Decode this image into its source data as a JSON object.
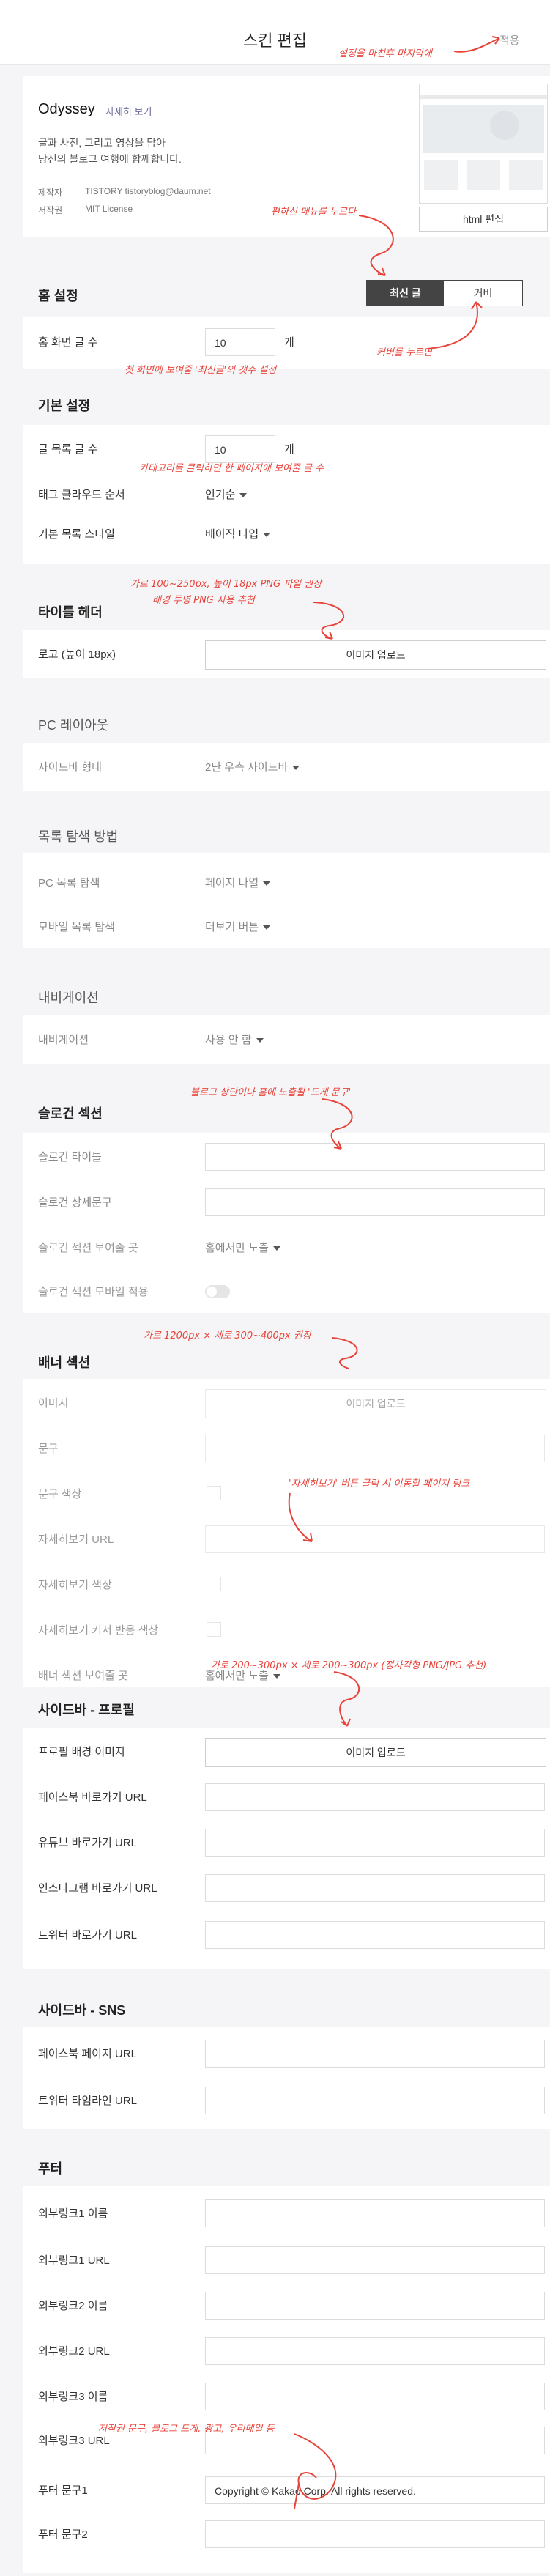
{
  "topbar": {
    "title": "스킨 편집",
    "apply_label": "적용"
  },
  "skin": {
    "name": "Odyssey",
    "detail_link": "자세히 보기",
    "description": "글과 사진, 그리고 영상을 담아\n당신의 블로그 여행에 함께합니다.",
    "meta": [
      {
        "label": "제작자",
        "value": "TISTORY  tistoryblog@daum.net"
      },
      {
        "label": "저작권",
        "value": "MIT License"
      }
    ],
    "html_edit_label": "html 편집"
  },
  "home": {
    "header": "홈 설정",
    "tabs": [
      {
        "label": "최신 글",
        "active": true
      },
      {
        "label": "커버",
        "active": false
      }
    ],
    "count_label": "홈 화면 글 수",
    "count_value": "10",
    "count_unit": "개"
  },
  "basic": {
    "header": "기본 설정",
    "list_count_label": "글 목록 글 수",
    "list_count_value": "10",
    "list_count_unit": "개",
    "tagcloud_label": "태그 클라우드 순서",
    "tagcloud_value": "인기순",
    "liststyle_label": "기본 목록 스타일",
    "liststyle_value": "베이직 타입"
  },
  "title_header": {
    "header": "타이틀 헤더",
    "logo_label": "로고 (높이 18px)",
    "upload_label": "이미지 업로드"
  },
  "pc_layout": {
    "header": "PC 레이아웃",
    "sidebar_label": "사이드바 형태",
    "sidebar_value": "2단 우측 사이드바"
  },
  "list_nav": {
    "header": "목록 탐색 방법",
    "pc_label": "PC 목록 탐색",
    "pc_value": "페이지 나열",
    "mobile_label": "모바일 목록 탐색",
    "mobile_value": "더보기 버튼"
  },
  "navigation": {
    "header": "내비게이션",
    "label": "내비게이션",
    "value": "사용 안 함"
  },
  "slogan": {
    "header": "슬로건 섹션",
    "title_label": "슬로건 타이틀",
    "desc_label": "슬로건 상세문구",
    "show_label": "슬로건 섹션 보여줄 곳",
    "show_value": "홈에서만 노출",
    "mobile_label": "슬로건 섹션 모바일 적용"
  },
  "banner": {
    "header": "배너 섹션",
    "image_label": "이미지",
    "upload_label": "이미지 업로드",
    "text_label": "문구",
    "text_color_label": "문구 색상",
    "more_url_label": "자세히보기 URL",
    "more_color_label": "자세히보기 색상",
    "cursor_label": "자세히보기 커서 반응 색상",
    "show_label": "배너 섹션 보여줄 곳",
    "show_value": "홈에서만 노출"
  },
  "profile": {
    "header": "사이드바 - 프로필",
    "bg_label": "프로필 배경 이미지",
    "upload_label": "이미지 업로드",
    "facebook_label": "페이스북 바로가기 URL",
    "youtube_label": "유튜브 바로가기 URL",
    "instagram_label": "인스타그램 바로가기 URL",
    "twitter_label": "트위터 바로가기 URL"
  },
  "sns": {
    "header": "사이드바 - SNS",
    "facebook_label": "페이스북 페이지 URL",
    "twitter_label": "트위터 타임라인 URL"
  },
  "footer": {
    "header": "푸터",
    "link1_name": "외부링크1 이름",
    "link1_url": "외부링크1 URL",
    "link2_name": "외부링크2 이름",
    "link2_url": "외부링크2 URL",
    "link3_name": "외부링크3 이름",
    "link3_url": "외부링크3 URL",
    "text1_label": "푸터 문구1",
    "text1_value": "Copyright © Kakao Corp. All rights reserved.",
    "text2_label": "푸터 문구2"
  },
  "annotations": {
    "apply": "설정을 마친후 마지막에",
    "cover": "편하신 메뉴를 누르다",
    "cover2": "커버를 누르면",
    "homecount": "첫 화면에 보여줄 '최신글'의 갯수 설정",
    "listcount": "카테고리를 클릭하면 한 페이지에 보여줄 글 수",
    "logo1": "가로 100~250px, 높이 18px PNG 파일 권장",
    "logo2": "배경 투명 PNG 사용 추천",
    "slogan": "블로그 상단이나 홈에 노출될 '드게 문구'",
    "banner": "가로 1200px × 세로 300~400px 권장",
    "moreurl": "'자세히보기' 버튼 클릭 시 이동할 페이지 링크",
    "profile": "가로 200~300px × 세로 200~300px (정사각형 PNG/JPG 추천)",
    "footer": "저작권 문구, 블로그 드게, 광고, 우리메일 등"
  },
  "colors": {
    "accent": "#e8433a",
    "tab_active": "#444444"
  }
}
